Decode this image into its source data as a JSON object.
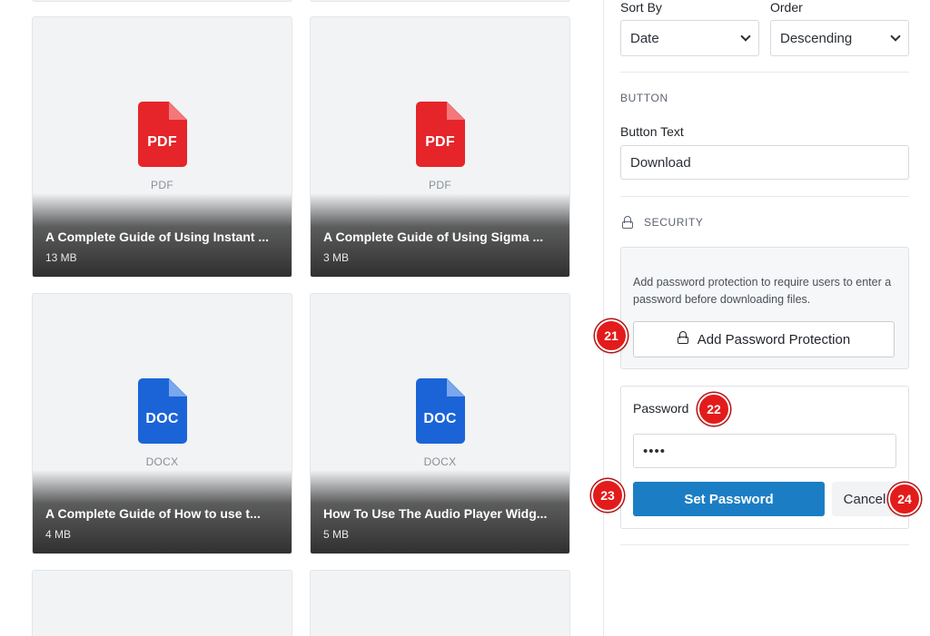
{
  "files": [
    {
      "icon": "pdf-file-icon",
      "badge": "PDF",
      "type": "PDF",
      "name": "A Complete Guide of Using Instant ...",
      "size": "13 MB"
    },
    {
      "icon": "pdf-file-icon",
      "badge": "PDF",
      "type": "PDF",
      "name": "A Complete Guide of Using Sigma ...",
      "size": "3 MB"
    },
    {
      "icon": "doc-file-icon",
      "badge": "DOC",
      "type": "DOCX",
      "name": "A Complete Guide of How to use t...",
      "size": "4 MB"
    },
    {
      "icon": "doc-file-icon",
      "badge": "DOC",
      "type": "DOCX",
      "name": "How To Use The Audio Player Widg...",
      "size": "5 MB"
    }
  ],
  "colors": {
    "pdf": "#e5252a",
    "doc": "#1b64d8",
    "primary": "#1b7ec4",
    "marker": "#e31b1b"
  },
  "sidebar": {
    "sort_by": {
      "label": "Sort By",
      "value": "Date"
    },
    "order": {
      "label": "Order",
      "value": "Descending"
    },
    "button_section": {
      "title": "BUTTON",
      "text_label": "Button Text",
      "text_value": "Download"
    },
    "security_section": {
      "title": "SECURITY",
      "description": "Add password protection to require users to enter a password before downloading files.",
      "add_button": "Add Password Protection"
    },
    "password_form": {
      "label": "Password",
      "value": "••••",
      "set_button": "Set Password",
      "cancel_button": "Cancel"
    }
  },
  "markers": [
    "21",
    "22",
    "23",
    "24"
  ]
}
